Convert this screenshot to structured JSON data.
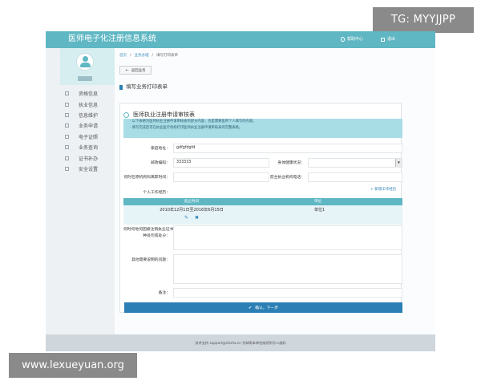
{
  "watermarks": {
    "top_right": "TG: MYYJJPP",
    "bottom_left": "www.lexueyuan.org"
  },
  "colors": {
    "accent": "#5fb7c3",
    "primary": "#2b7fb4",
    "notice_bg": "#a8dde6"
  },
  "header": {
    "title": "医师电子化注册信息系统",
    "help_label": "帮助中心",
    "logout_label": "退出",
    "help_icon": "bulb-icon",
    "logout_icon": "exit-icon"
  },
  "sidebar": {
    "items": [
      {
        "label": "资格信息",
        "icon": "document-icon"
      },
      {
        "label": "执业信息",
        "icon": "user-icon"
      },
      {
        "label": "信息维护",
        "icon": "edit-icon"
      },
      {
        "label": "业务申请",
        "icon": "form-icon"
      },
      {
        "label": "电子证照",
        "icon": "certificate-icon"
      },
      {
        "label": "业务查询",
        "icon": "search-icon"
      },
      {
        "label": "证书补办",
        "icon": "reissue-icon"
      },
      {
        "label": "安全设置",
        "icon": "lock-icon"
      }
    ]
  },
  "breadcrumb": [
    "首页",
    "业务办理",
    "填写打印表单"
  ],
  "toolbar": {
    "back_label": "返回业务"
  },
  "section": {
    "title": "填写业务打印表单"
  },
  "form": {
    "title": "医师执业注册申请审核表",
    "notice_lines": [
      "· 以下表格为医师执业注册申请审核表的部分内容，也是需要医师个人填写的内容。",
      "· 填写完成后可在执业医疗机构打印医师执业注册申请审核表的完整表格。"
    ],
    "fields": {
      "home_address": {
        "label": "家庭地址：",
        "value": "gdfgfdgfd"
      },
      "postal_code": {
        "label": "邮政编码：",
        "value": "333333"
      },
      "health_status": {
        "label": "身体健康状况：",
        "value": ""
      },
      "prev_unit_left_time": {
        "label": "何时在原机构科离职时间：",
        "value": ""
      },
      "prev_unit_phone": {
        "label": "前主执业机构电话：",
        "value": ""
      },
      "work_history": {
        "label": "个人工作经历："
      },
      "license_revoked": {
        "label": "何时何地何因被注销执业证书",
        "label2": "种处罚或处分：",
        "value": ""
      },
      "other_notes": {
        "label": "其他需要说明的问题：",
        "value": ""
      },
      "remarks": {
        "label": "备注：",
        "value": ""
      }
    },
    "add_work_label": "+ 新增工作经历",
    "work_table": {
      "headers": [
        "起止时间",
        "单位"
      ],
      "rows": [
        {
          "period": "2010年12月1日至2016年6月15日",
          "unit": "单位1"
        }
      ]
    },
    "submit_label": "确认，下一步"
  },
  "footer": {
    "text": "技术支持 support@ntisha.cn 为邮寄本单验候领到号二维码"
  }
}
